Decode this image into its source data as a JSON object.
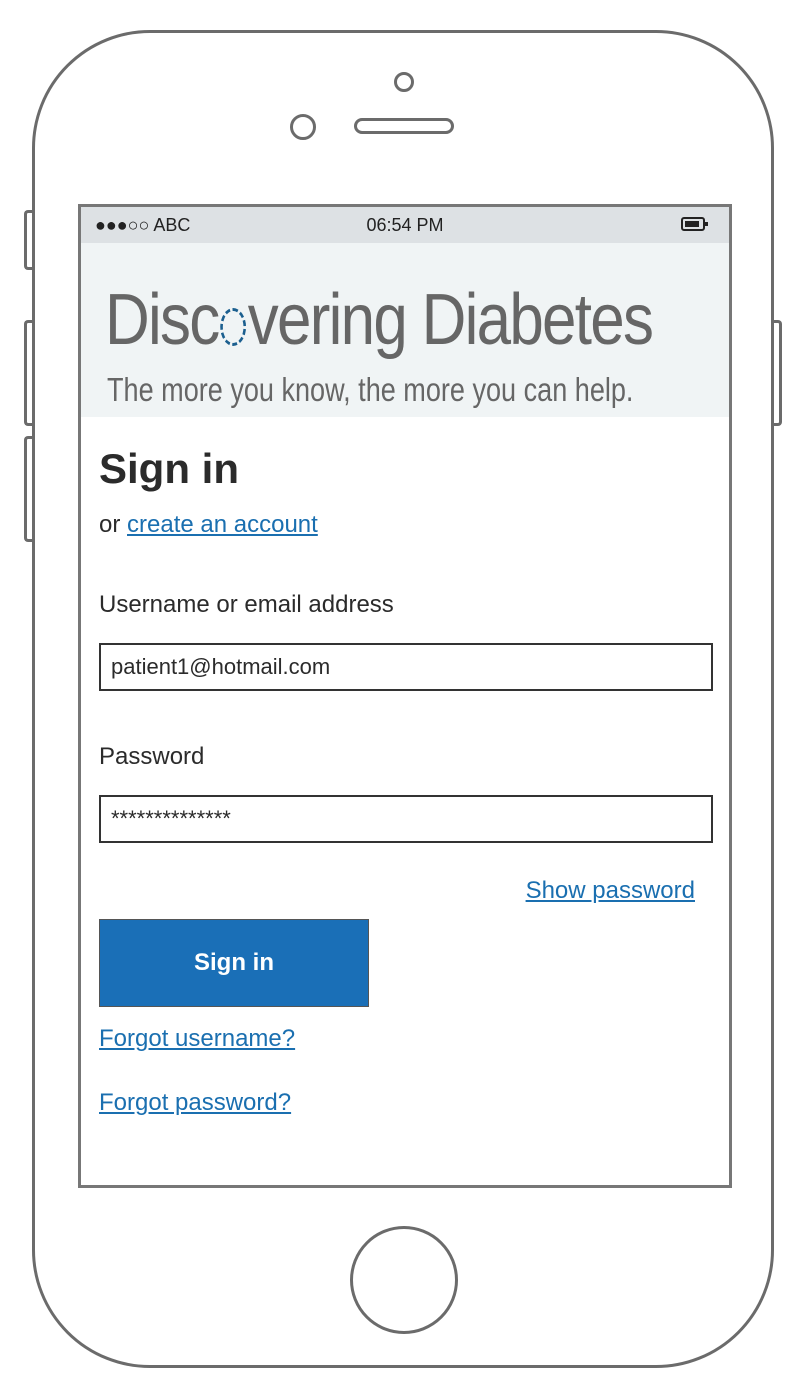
{
  "status_bar": {
    "carrier": "●●●○○ ABC",
    "time": "06:54 PM",
    "battery_icon": "battery-icon"
  },
  "banner": {
    "title_before": "Disc",
    "title_after": "vering Diabetes",
    "subtitle": "The more you know, the more you can help."
  },
  "signin": {
    "heading": "Sign in",
    "or_text": "or ",
    "create_account_link": "create an account",
    "username_label": "Username or email address",
    "username_value": "patient1@hotmail.com",
    "password_label": "Password",
    "password_value": "**************",
    "show_password_link": "Show password",
    "submit_label": "Sign in",
    "forgot_username_link": "Forgot username?",
    "forgot_password_link": "Forgot password?"
  },
  "colors": {
    "accent": "#1a6fb7",
    "link": "#1a6fb0",
    "banner_bg": "#f0f4f5",
    "status_bar_bg": "#dde1e4"
  }
}
